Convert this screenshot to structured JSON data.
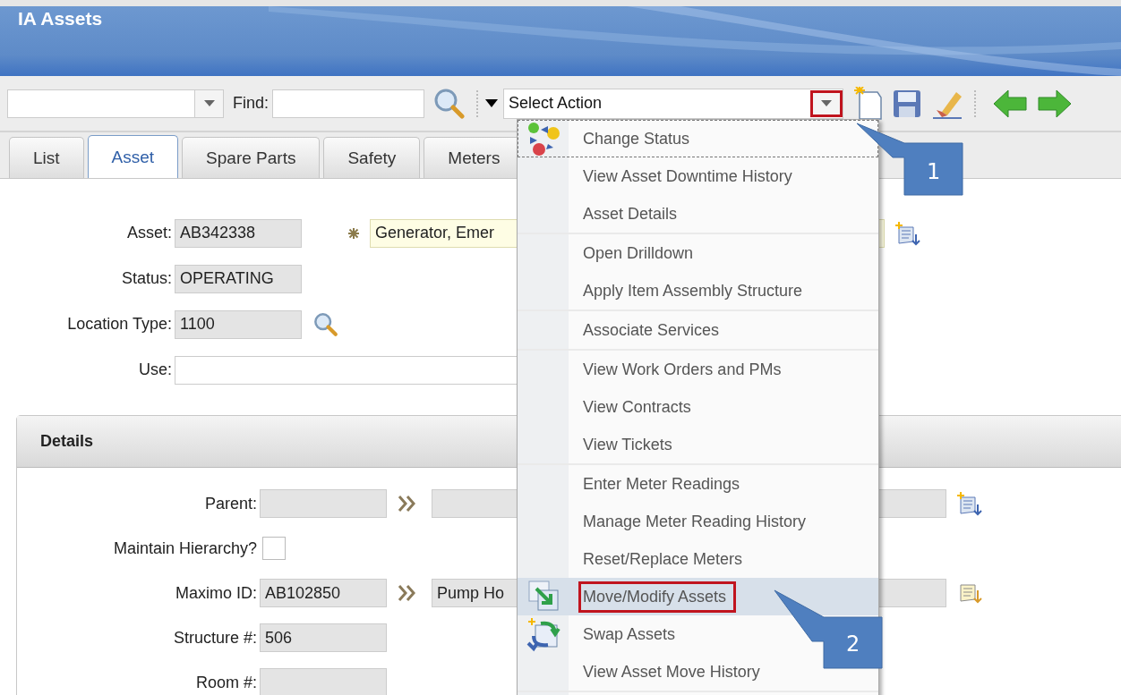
{
  "window": {
    "title": "IA Assets"
  },
  "toolbar": {
    "find_label": "Find:",
    "select_action": {
      "value": "Select Action",
      "outlined": true
    }
  },
  "tabs": [
    {
      "label": "List",
      "selected": false
    },
    {
      "label": "Asset",
      "selected": true
    },
    {
      "label": "Spare Parts",
      "selected": false
    },
    {
      "label": "Safety",
      "selected": false
    },
    {
      "label": "Meters",
      "selected": false
    }
  ],
  "asset_form": {
    "asset": {
      "label": "Asset:",
      "value": "AB342338"
    },
    "description": "Generator, Emer",
    "status": {
      "label": "Status:",
      "value": "OPERATING"
    },
    "location_type": {
      "label": "Location Type:",
      "value": "1100"
    },
    "use": {
      "label": "Use:"
    }
  },
  "details": {
    "title": "Details",
    "parent": {
      "label": "Parent:"
    },
    "maintain_hierarchy": {
      "label": "Maintain Hierarchy?",
      "checked": false
    },
    "maximo_id": {
      "label": "Maximo ID:",
      "value": "AB102850",
      "description": "Pump Ho"
    },
    "structure": {
      "label": "Structure #:",
      "value": "506"
    },
    "room": {
      "label": "Room #:"
    }
  },
  "action_menu": {
    "groups": [
      [
        {
          "label": "Change Status",
          "kind": "status",
          "selected": false,
          "focused": true,
          "outlined": false
        },
        {
          "label": "View Asset Downtime History",
          "selected": false,
          "focused": false,
          "outlined": false
        },
        {
          "label": "Asset Details",
          "selected": false,
          "focused": false,
          "outlined": false
        }
      ],
      [
        {
          "label": "Open Drilldown",
          "selected": false,
          "focused": false,
          "outlined": false
        },
        {
          "label": "Apply Item Assembly Structure",
          "selected": false,
          "focused": false,
          "outlined": false
        }
      ],
      [
        {
          "label": "Associate Services",
          "selected": false,
          "focused": false,
          "outlined": false
        }
      ],
      [
        {
          "label": "View Work Orders and PMs",
          "selected": false,
          "focused": false,
          "outlined": false
        },
        {
          "label": "View Contracts",
          "selected": false,
          "focused": false,
          "outlined": false
        },
        {
          "label": "View Tickets",
          "selected": false,
          "focused": false,
          "outlined": false
        }
      ],
      [
        {
          "label": "Enter Meter Readings",
          "selected": false,
          "focused": false,
          "outlined": false
        },
        {
          "label": "Manage Meter Reading History",
          "selected": false,
          "focused": false,
          "outlined": false
        },
        {
          "label": "Reset/Replace Meters",
          "selected": false,
          "focused": false,
          "outlined": false
        },
        {
          "label": "Move/Modify Assets",
          "kind": "move",
          "selected": true,
          "focused": false,
          "outlined": true
        },
        {
          "label": "Swap Assets",
          "kind": "swap",
          "selected": false,
          "focused": false,
          "outlined": false
        },
        {
          "label": "View Asset Move History",
          "selected": false,
          "focused": false,
          "outlined": false
        }
      ]
    ]
  },
  "callouts": [
    {
      "number": "1"
    },
    {
      "number": "2"
    }
  ]
}
